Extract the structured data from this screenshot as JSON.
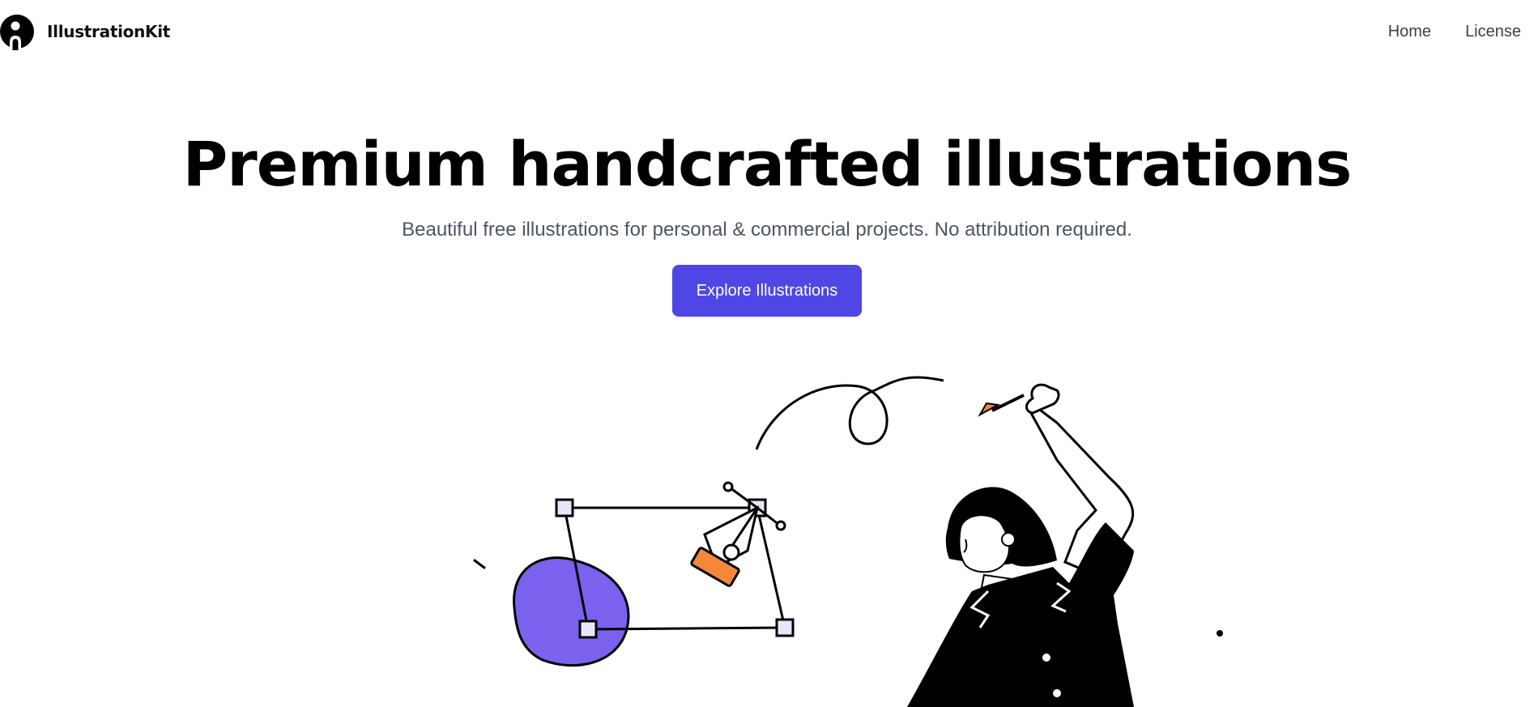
{
  "header": {
    "brand_name": "IllustrationKit",
    "logo_icon": "person-circle-logo-icon",
    "nav": [
      {
        "label": "Home"
      },
      {
        "label": "License"
      }
    ]
  },
  "hero": {
    "title": "Premium handcrafted illustrations",
    "subtitle": "Beautiful free illustrations for personal & commercial projects. No attribution required.",
    "cta_label": "Explore Illustrations"
  },
  "colors": {
    "accent": "#4f46e5",
    "illustration_purple": "#7b61ee",
    "illustration_orange": "#f5873a",
    "text_dark": "#000000",
    "text_muted": "#4b5563"
  }
}
